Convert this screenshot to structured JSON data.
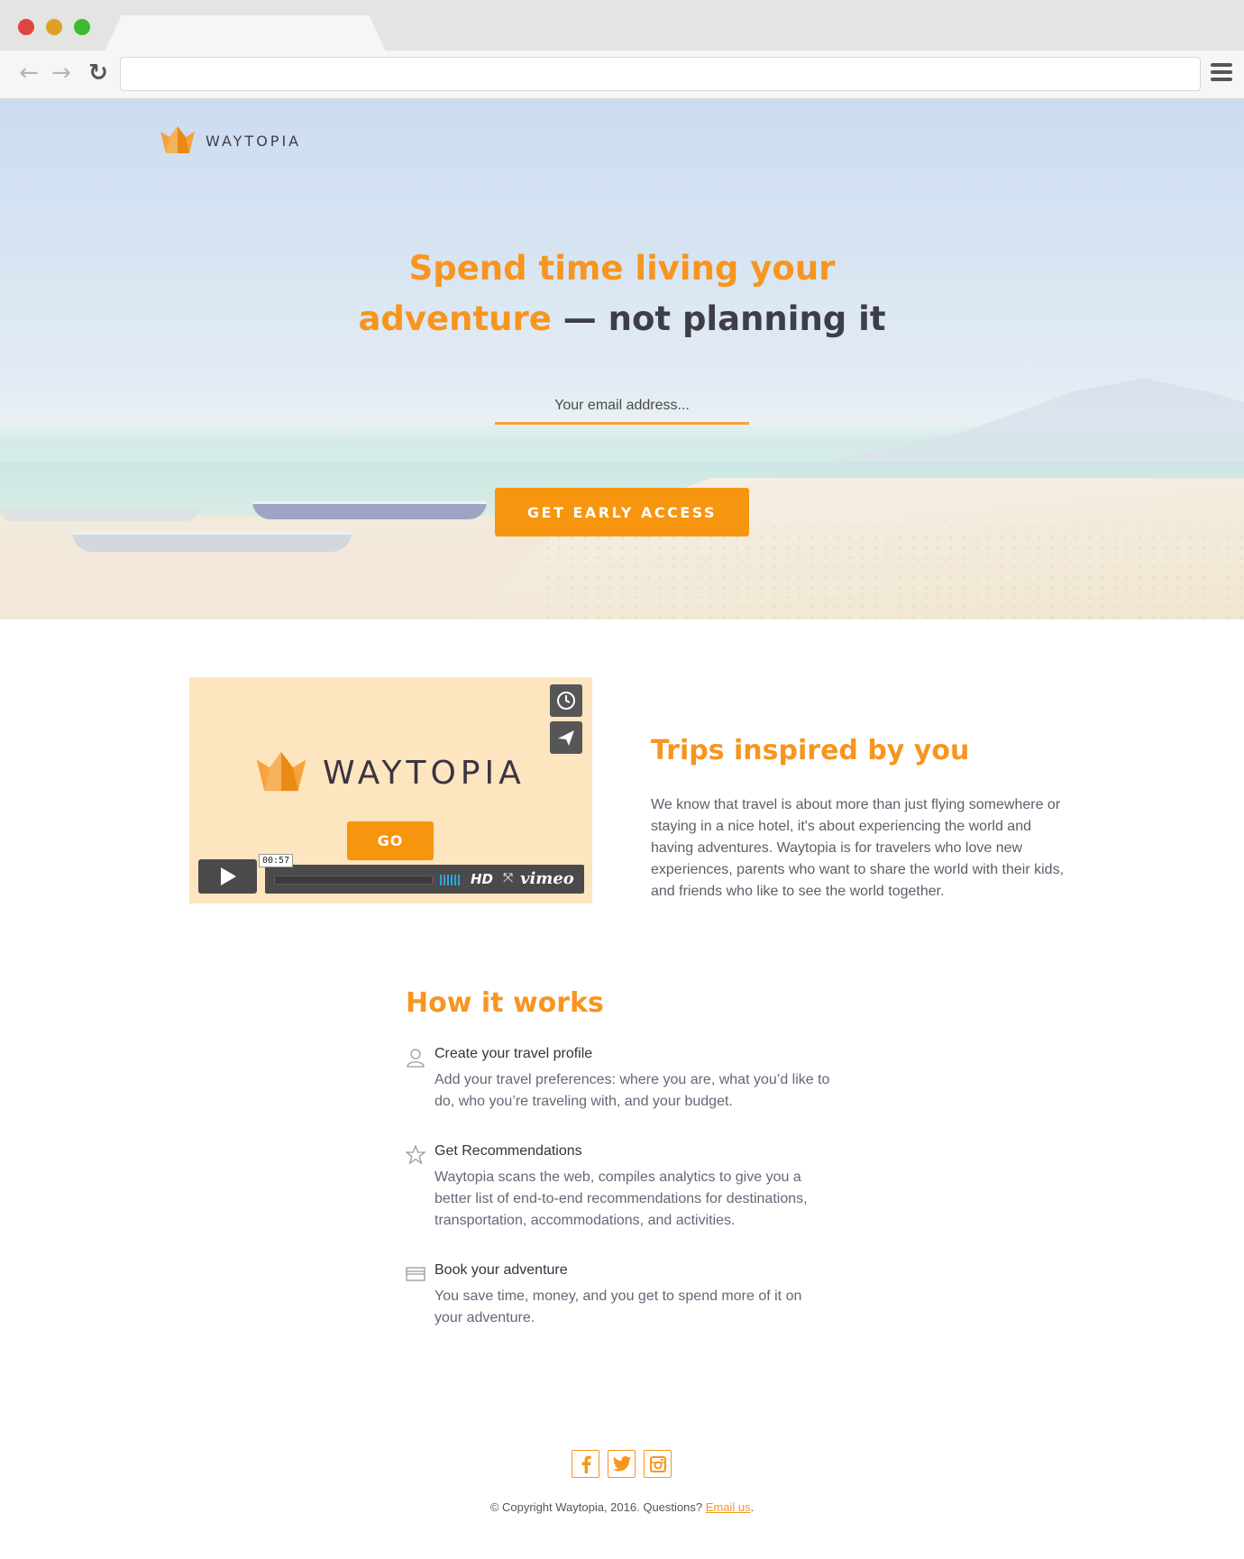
{
  "browser": {
    "address": "",
    "back_icon": "arrow-left-icon",
    "forward_icon": "arrow-right-icon",
    "reload_icon": "reload-icon",
    "menu_icon": "hamburger-menu-icon"
  },
  "brand": {
    "name": "WAYTOPIA",
    "accent_color": "#f7951f"
  },
  "hero": {
    "title_orange": "Spend time living your adventure",
    "title_dark": " — not planning it",
    "email_placeholder": "Your email address...",
    "cta_label": "GET EARLY ACCESS"
  },
  "video": {
    "logo_text": "WAYTOPIA",
    "go_label": "GO",
    "time": "00:57",
    "hd_label": "HD",
    "vimeo_label": "vimeo"
  },
  "trips": {
    "title": "Trips inspired by you",
    "body": "We know that travel is about more than just flying somewhere or staying in a nice hotel, it's about experiencing the world and having adventures. Waytopia is for travelers who love new experiences, parents who want to share the world with their kids, and friends who like to see the world together."
  },
  "how": {
    "title": "How it works",
    "steps": [
      {
        "icon": "user-icon",
        "title": "Create your travel profile",
        "desc": "Add your travel preferences: where you are, what you’d like to do, who you’re traveling with, and your budget."
      },
      {
        "icon": "star-icon",
        "title": "Get Recommendations",
        "desc": "Waytopia scans the web, compiles analytics to give you a better list of end-to-end recommendations for destinations, transportation, accommodations, and activities."
      },
      {
        "icon": "credit-card-icon",
        "title": "Book your adventure",
        "desc": "You save time, money, and you get to spend more of it on your adventure."
      }
    ]
  },
  "footer": {
    "social": [
      "facebook-icon",
      "twitter-icon",
      "instagram-icon"
    ],
    "copyright": "© Copyright Waytopia, 2016. Questions? ",
    "email_link": "Email us",
    "after_link": "."
  }
}
